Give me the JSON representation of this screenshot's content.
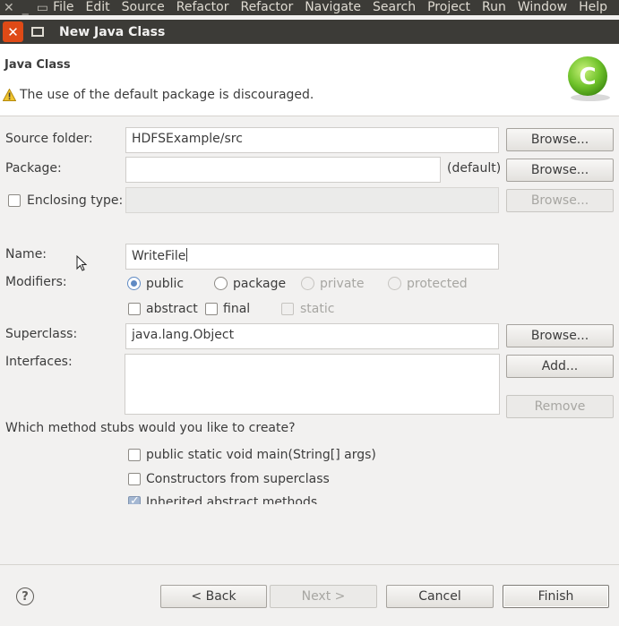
{
  "menubar": {
    "items": [
      "File",
      "Edit",
      "Source",
      "Refactor",
      "Refactor",
      "Navigate",
      "Search",
      "Project",
      "Run",
      "Window",
      "Help"
    ]
  },
  "dialog": {
    "title": "New Java Class",
    "close_glyph": "✕"
  },
  "banner": {
    "heading": "Java Class",
    "warning": "The use of the default package is discouraged.",
    "logo_letter": "C"
  },
  "form": {
    "source_folder": {
      "label": "Source folder:",
      "value": "HDFSExample/src",
      "browse": "Browse..."
    },
    "package": {
      "label": "Package:",
      "value": "",
      "suffix": "(default)",
      "browse": "Browse..."
    },
    "enclosing_type": {
      "label": "Enclosing type:",
      "value": "",
      "browse": "Browse..."
    },
    "name": {
      "label": "Name:",
      "value": "WriteFile"
    },
    "modifiers": {
      "label": "Modifiers:",
      "access": [
        "public",
        "package",
        "private",
        "protected"
      ],
      "selected_access": "public",
      "flags": [
        "abstract",
        "final",
        "static"
      ]
    },
    "superclass": {
      "label": "Superclass:",
      "value": "java.lang.Object",
      "browse": "Browse..."
    },
    "interfaces": {
      "label": "Interfaces:",
      "add": "Add...",
      "remove": "Remove"
    },
    "stubs": {
      "question": "Which method stubs would you like to create?",
      "options": [
        "public static void main(String[] args)",
        "Constructors from superclass",
        "Inherited abstract methods"
      ]
    }
  },
  "footer": {
    "help_glyph": "?",
    "back": "< Back",
    "next": "Next >",
    "cancel": "Cancel",
    "finish": "Finish"
  },
  "colors": {
    "titlebar": "#3c3b37",
    "close_button": "#df4a16",
    "dialog_bg": "#f2f1f0",
    "radio_accent": "#5f8ac4"
  }
}
